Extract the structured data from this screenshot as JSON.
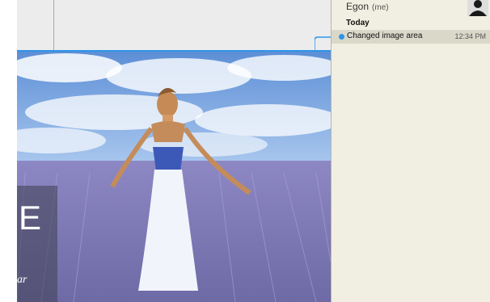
{
  "history_panel": {
    "user_name": "Egon",
    "user_me": "(me)",
    "day_header": "Today",
    "entries": [
      {
        "label": "Changed image area",
        "time": "12:34 PM"
      }
    ]
  },
  "slide_overlay": {
    "letter": "E",
    "italic_fragment": "ar"
  },
  "colors": {
    "accent": "#2e94e8",
    "panel_bg": "#f1efe1",
    "selected_row": "#dad8c9"
  },
  "icons": [
    "avatar-icon",
    "history-dot-icon"
  ]
}
